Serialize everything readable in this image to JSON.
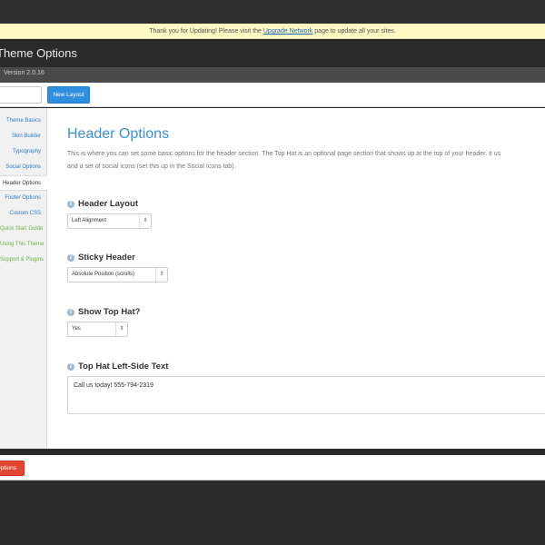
{
  "notice": {
    "before": "Thank you for Updating! Please visit the ",
    "link": "Upgrade Network",
    "after": " page to update all your sites."
  },
  "header": {
    "title": "Theme Options",
    "version": "Version 2.0.16"
  },
  "toolbar": {
    "new_layout_label": "New Layout"
  },
  "sidebar": {
    "items": [
      {
        "label": "Theme Basics"
      },
      {
        "label": "Skin Builder"
      },
      {
        "label": "Typography"
      },
      {
        "label": "Social Options"
      },
      {
        "label": "Header Options"
      },
      {
        "label": "Footer Options"
      },
      {
        "label": "Custom CSS"
      },
      {
        "label": "Quick Start Guide"
      },
      {
        "label": "Using This Theme"
      },
      {
        "label": "Support & Plugins"
      }
    ],
    "active": "Header Options"
  },
  "main": {
    "heading": "Header Options",
    "description_line1": "This is where you can set some basic options for the header section. The Top Hat is an optional page section that shows up at the top of your header. It us",
    "description_line2": "and a set of social icons (set this up in the Social Icons tab).",
    "options": {
      "header_layout": {
        "title": "Header Layout",
        "value": "Left Alignment"
      },
      "sticky_header": {
        "title": "Sticky Header",
        "value": "Absolute Position (scrolls)"
      },
      "show_top_hat": {
        "title": "Show Top Hat?",
        "value": "Yes"
      },
      "top_hat_left_text": {
        "title": "Top Hat Left-Side Text",
        "value": "Call us today! 555-794-2319"
      }
    }
  },
  "footer": {
    "save_label": "Options"
  },
  "colors": {
    "accent_blue": "#3c8fd6",
    "button_blue": "#2f8ede",
    "button_red": "#e0462f",
    "notice_bg": "#fff7c2",
    "green_link": "#6db33f"
  }
}
